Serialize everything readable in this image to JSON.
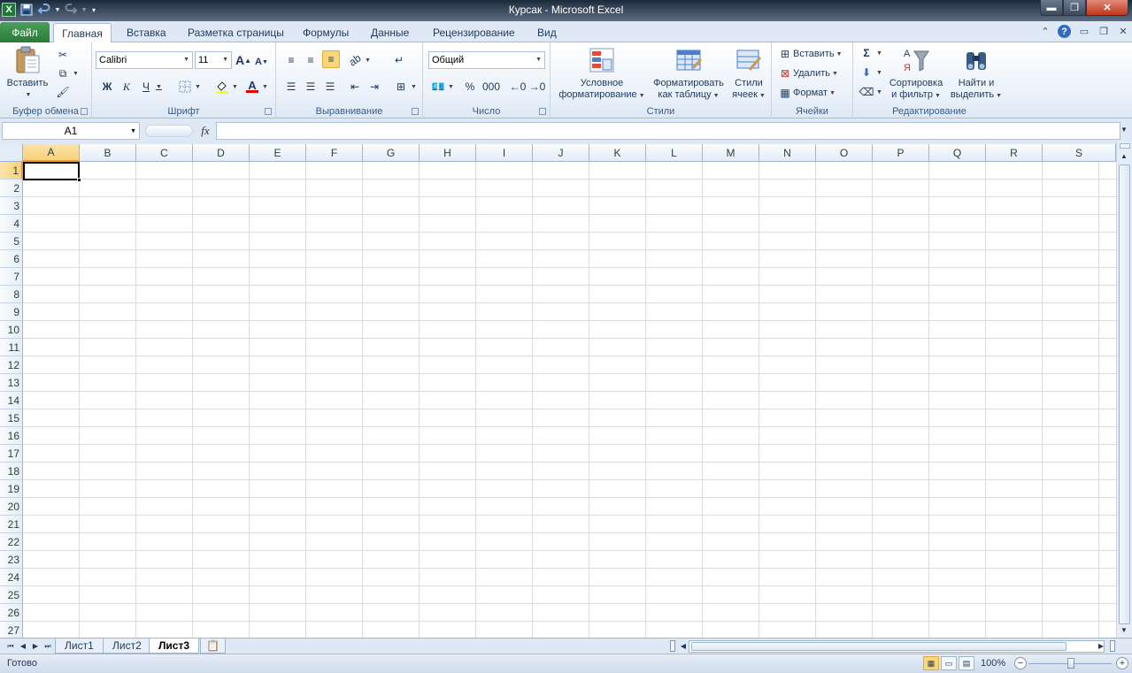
{
  "window": {
    "title": "Курсак  -  Microsoft Excel",
    "minimize_icon": "minimize-icon",
    "maximize_icon": "maximize-icon",
    "close_icon": "close-icon"
  },
  "quick_access": {
    "app_icon": "X",
    "save_icon": "save-icon",
    "undo_icon": "undo-icon",
    "redo_icon": "redo-icon"
  },
  "tabs": [
    "Файл",
    "Главная",
    "Вставка",
    "Разметка страницы",
    "Формулы",
    "Данные",
    "Рецензирование",
    "Вид"
  ],
  "ribbon": {
    "clipboard": {
      "label": "Буфер обмена",
      "paste": "Вставить"
    },
    "font": {
      "label": "Шрифт",
      "font_name": "Calibri",
      "font_size": "11",
      "bold": "Ж",
      "italic": "К",
      "underline": "Ч",
      "grow": "A",
      "shrink": "A"
    },
    "alignment": {
      "label": "Выравнивание"
    },
    "number": {
      "label": "Число",
      "format": "Общий",
      "percent": "%",
      "thousands": "000"
    },
    "styles": {
      "label": "Стили",
      "conditional_1": "Условное",
      "conditional_2": "форматирование",
      "as_table_1": "Форматировать",
      "as_table_2": "как таблицу",
      "cell_styles_1": "Стили",
      "cell_styles_2": "ячеек"
    },
    "cells": {
      "label": "Ячейки",
      "insert": "Вставить",
      "delete": "Удалить",
      "format": "Формат"
    },
    "editing": {
      "label": "Редактирование",
      "sum": "Σ",
      "sort_1": "Сортировка",
      "sort_2": "и фильтр",
      "find_1": "Найти и",
      "find_2": "выделить"
    }
  },
  "formula_bar": {
    "name_box": "A1",
    "fx": "fx",
    "formula": ""
  },
  "grid": {
    "columns": [
      "A",
      "B",
      "C",
      "D",
      "E",
      "F",
      "G",
      "H",
      "I",
      "J",
      "K",
      "L",
      "M",
      "N",
      "O",
      "P",
      "Q",
      "R",
      "S"
    ],
    "rows": [
      "1",
      "2",
      "3",
      "4",
      "5",
      "6",
      "7",
      "8",
      "9",
      "10",
      "11",
      "12",
      "13",
      "14",
      "15",
      "16",
      "17",
      "18",
      "19",
      "20",
      "21",
      "22",
      "23",
      "24",
      "25",
      "26",
      "27"
    ],
    "active_cell": "A1"
  },
  "sheets": [
    "Лист1",
    "Лист2",
    "Лист3"
  ],
  "active_sheet": "Лист3",
  "status": {
    "text": "Готово",
    "zoom": "100%"
  },
  "colors": {
    "file_tab": "#2a7a38",
    "selected_header": "#f9d17b",
    "grid_line": "#dadcdd"
  }
}
